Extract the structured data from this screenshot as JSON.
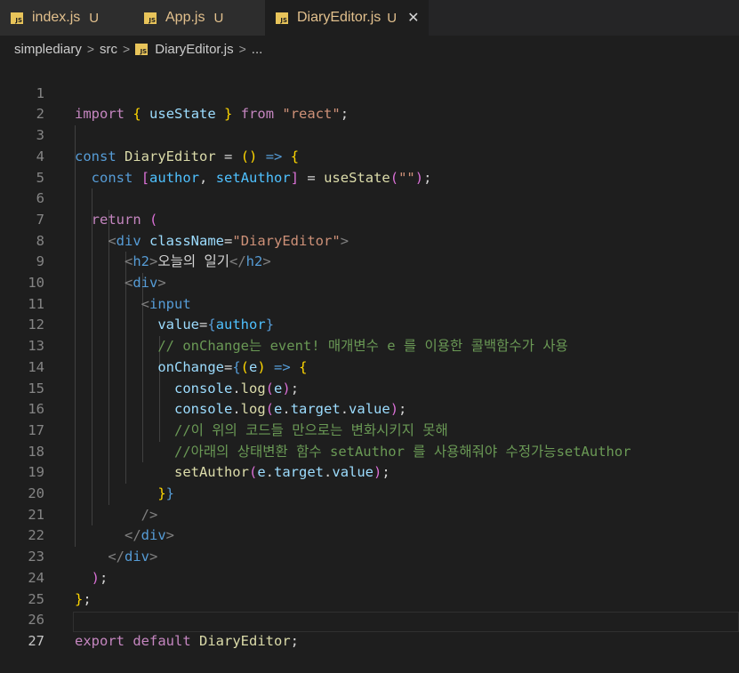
{
  "tabs": [
    {
      "label": "index.js",
      "status": "U",
      "icon": "js-file-icon"
    },
    {
      "label": "App.js",
      "status": "U",
      "icon": "js-file-icon"
    },
    {
      "label": "DiaryEditor.js",
      "status": "U",
      "icon": "js-file-icon",
      "active": true,
      "close": "✕"
    }
  ],
  "breadcrumb": {
    "items": [
      "simplediary",
      "src",
      "DiaryEditor.js",
      "..."
    ],
    "separator": ">"
  },
  "colors": {
    "background": "#1e1e1e",
    "tab_label": "#e2c08d",
    "keyword": "#569cd6",
    "control": "#c586c0",
    "variable": "#9cdcfe",
    "function": "#dcdcaa",
    "string": "#ce9178",
    "comment": "#6a9955"
  },
  "editor": {
    "active_line": 27,
    "lines": [
      {
        "n": "1"
      },
      {
        "n": "2"
      },
      {
        "n": "3"
      },
      {
        "n": "4"
      },
      {
        "n": "5"
      },
      {
        "n": "6"
      },
      {
        "n": "7"
      },
      {
        "n": "8"
      },
      {
        "n": "9"
      },
      {
        "n": "10"
      },
      {
        "n": "11"
      },
      {
        "n": "12"
      },
      {
        "n": "13"
      },
      {
        "n": "14"
      },
      {
        "n": "15"
      },
      {
        "n": "16"
      },
      {
        "n": "17"
      },
      {
        "n": "18"
      },
      {
        "n": "19"
      },
      {
        "n": "20"
      },
      {
        "n": "21"
      },
      {
        "n": "22"
      },
      {
        "n": "23"
      },
      {
        "n": "24"
      },
      {
        "n": "25"
      },
      {
        "n": "26"
      },
      {
        "n": "27"
      }
    ],
    "tokens": {
      "l1": [
        "import",
        "{",
        "useState",
        "}",
        "from",
        "\"react\"",
        ";"
      ],
      "l3": [
        "const",
        "DiaryEditor",
        "=",
        "()",
        "=>",
        "{"
      ],
      "l4": [
        "const",
        "[",
        "author",
        ", ",
        "setAuthor",
        "]",
        "=",
        "useState",
        "(",
        "\"\"",
        ")",
        ";"
      ],
      "l6": [
        "return",
        "("
      ],
      "l7": [
        "<",
        "div",
        "className",
        "=",
        "\"DiaryEditor\"",
        ">"
      ],
      "l8": [
        "<",
        "h2",
        ">",
        "오늘의 일기",
        "</",
        "h2",
        ">"
      ],
      "l9": [
        "<",
        "div",
        ">"
      ],
      "l10": [
        "<",
        "input"
      ],
      "l11": [
        "value",
        "=",
        "{",
        "author",
        "}"
      ],
      "l12": [
        "// onChange는 event! 매개변수 e 를 이용한 콜백함수가 사용"
      ],
      "l13": [
        "onChange",
        "=",
        "{",
        "(",
        "e",
        ")",
        "=>",
        "{"
      ],
      "l14": [
        "console",
        ".",
        "log",
        "(",
        "e",
        ")",
        ";"
      ],
      "l15": [
        "console",
        ".",
        "log",
        "(",
        "e",
        ".",
        "target",
        ".",
        "value",
        ")",
        ";"
      ],
      "l16": [
        "//이 위의 코드들 만으로는 변화시키지 못해"
      ],
      "l17": [
        "//아래의 상태변환 함수 setAuthor 를 사용해줘야 수정가능setAuthor"
      ],
      "l18": [
        "setAuthor",
        "(",
        "e",
        ".",
        "target",
        ".",
        "value",
        ")",
        ";"
      ],
      "l19": [
        "}",
        "}"
      ],
      "l20": [
        "/>"
      ],
      "l21": [
        "</",
        "div",
        ">"
      ],
      "l22": [
        "</",
        "div",
        ">"
      ],
      "l23": [
        ")",
        ";"
      ],
      "l24": [
        "}",
        ";"
      ],
      "l26": [
        "export",
        "default",
        "DiaryEditor",
        ";"
      ]
    }
  }
}
